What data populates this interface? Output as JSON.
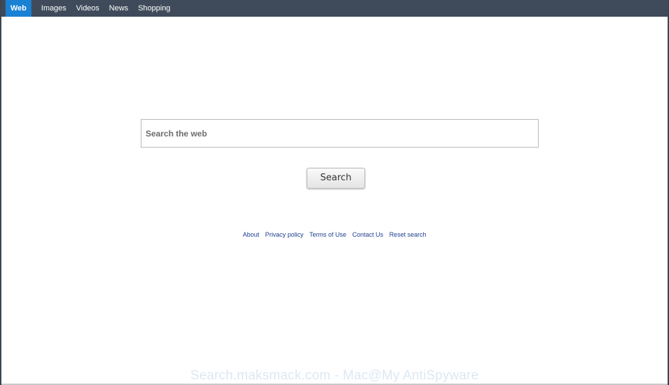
{
  "nav": {
    "tabs": [
      {
        "label": "Web"
      },
      {
        "label": "Images"
      },
      {
        "label": "Videos"
      },
      {
        "label": "News"
      },
      {
        "label": "Shopping"
      }
    ],
    "active_tab": "Web"
  },
  "search": {
    "placeholder": "Search the web",
    "value": "",
    "button_label": "Search"
  },
  "footer": {
    "links": [
      {
        "label": "About"
      },
      {
        "label": "Privacy policy"
      },
      {
        "label": "Terms of Use"
      },
      {
        "label": "Contact Us"
      },
      {
        "label": "Reset search"
      }
    ]
  },
  "watermark": "Search.maksmack.com - Mac@My AntiSpyware",
  "colors": {
    "topbar": "#3f4b5a",
    "active_tab": "#1a82d4",
    "link": "#1d3d8f"
  }
}
